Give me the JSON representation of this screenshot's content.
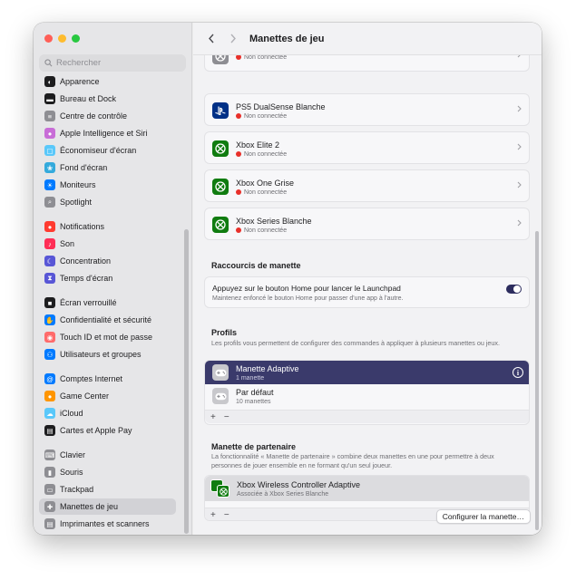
{
  "window": {
    "traffic_lights": [
      "#ff5f57",
      "#febc2e",
      "#28c840"
    ]
  },
  "search": {
    "placeholder": "Rechercher"
  },
  "sidebar": {
    "items": [
      {
        "label": "Apparence",
        "icon": "appearance-icon",
        "color": "#1d1d1f"
      },
      {
        "label": "Bureau et Dock",
        "icon": "dock-icon",
        "color": "#1d1d1f"
      },
      {
        "label": "Centre de contrôle",
        "icon": "control-center-icon",
        "color": "#8e8e93"
      },
      {
        "label": "Apple Intelligence et Siri",
        "icon": "siri-icon",
        "color": "#c86dd7"
      },
      {
        "label": "Économiseur d'écran",
        "icon": "screensaver-icon",
        "color": "#5ac8fa"
      },
      {
        "label": "Fond d'écran",
        "icon": "wallpaper-icon",
        "color": "#34aadc"
      },
      {
        "label": "Moniteurs",
        "icon": "displays-icon",
        "color": "#007aff"
      },
      {
        "label": "Spotlight",
        "icon": "spotlight-icon",
        "color": "#8e8e93"
      },
      {
        "label": "Notifications",
        "icon": "notifications-icon",
        "color": "#ff3b30"
      },
      {
        "label": "Son",
        "icon": "sound-icon",
        "color": "#ff2d55"
      },
      {
        "label": "Concentration",
        "icon": "focus-icon",
        "color": "#5856d6"
      },
      {
        "label": "Temps d'écran",
        "icon": "screen-time-icon",
        "color": "#5856d6"
      },
      {
        "label": "Écran verrouillé",
        "icon": "lock-screen-icon",
        "color": "#1d1d1f"
      },
      {
        "label": "Confidentialité et sécurité",
        "icon": "privacy-icon",
        "color": "#007aff"
      },
      {
        "label": "Touch ID et mot de passe",
        "icon": "touch-id-icon",
        "color": "#ff6b6b"
      },
      {
        "label": "Utilisateurs et groupes",
        "icon": "users-icon",
        "color": "#007aff"
      },
      {
        "label": "Comptes Internet",
        "icon": "internet-accounts-icon",
        "color": "#007aff"
      },
      {
        "label": "Game Center",
        "icon": "game-center-icon",
        "color": "#ff9500"
      },
      {
        "label": "iCloud",
        "icon": "icloud-icon",
        "color": "#5ac8fa"
      },
      {
        "label": "Cartes et Apple Pay",
        "icon": "wallet-icon",
        "color": "#1d1d1f"
      },
      {
        "label": "Clavier",
        "icon": "keyboard-icon",
        "color": "#8e8e93"
      },
      {
        "label": "Souris",
        "icon": "mouse-icon",
        "color": "#8e8e93"
      },
      {
        "label": "Trackpad",
        "icon": "trackpad-icon",
        "color": "#8e8e93"
      },
      {
        "label": "Manettes de jeu",
        "icon": "game-controller-icon",
        "color": "#8e8e93",
        "selected": true
      },
      {
        "label": "Imprimantes et scanners",
        "icon": "printer-icon",
        "color": "#8e8e93"
      }
    ]
  },
  "toolbar": {
    "title": "Manettes de jeu",
    "back_icon": "chevron-left-icon",
    "forward_icon": "chevron-right-icon"
  },
  "devices": [
    {
      "name": "",
      "status": "Non connectée",
      "icon": "xbox-icon",
      "color": "#8e8e93"
    },
    {
      "name": "PS5 DualSense Blanche",
      "status": "Non connectée",
      "icon": "playstation-icon",
      "color": "#003087"
    },
    {
      "name": "Xbox Elite 2",
      "status": "Non connectée",
      "icon": "xbox-icon",
      "color": "#107c10"
    },
    {
      "name": "Xbox One Grise",
      "status": "Non connectée",
      "icon": "xbox-icon",
      "color": "#107c10"
    },
    {
      "name": "Xbox Series Blanche",
      "status": "Non connectée",
      "icon": "xbox-icon",
      "color": "#107c10"
    }
  ],
  "shortcuts": {
    "title": "Raccourcis de manette",
    "row_title": "Appuyez sur le bouton Home pour lancer le Launchpad",
    "row_desc": "Maintenez enfoncé le bouton Home pour passer d'une app à l'autre.",
    "toggle_on": true
  },
  "profiles": {
    "title": "Profils",
    "desc": "Les profils vous permettent de configurer des commandes à appliquer à plusieurs manettes ou jeux.",
    "items": [
      {
        "name": "Manette Adaptive",
        "sub": "1 manette",
        "selected": true
      },
      {
        "name": "Par défaut",
        "sub": "10 manettes",
        "selected": false
      }
    ],
    "add_label": "+",
    "remove_label": "−"
  },
  "partner": {
    "title": "Manette de partenaire",
    "desc": "La fonctionnalité « Manette de partenaire » combine deux manettes en une pour permettre à deux personnes de jouer ensemble en ne formant qu'un seul joueur.",
    "item": {
      "name": "Xbox Wireless Controller Adaptive",
      "sub": "Associée à Xbox Series Blanche"
    },
    "add_label": "+",
    "remove_label": "−"
  },
  "configure_button": "Configurer la manette…"
}
